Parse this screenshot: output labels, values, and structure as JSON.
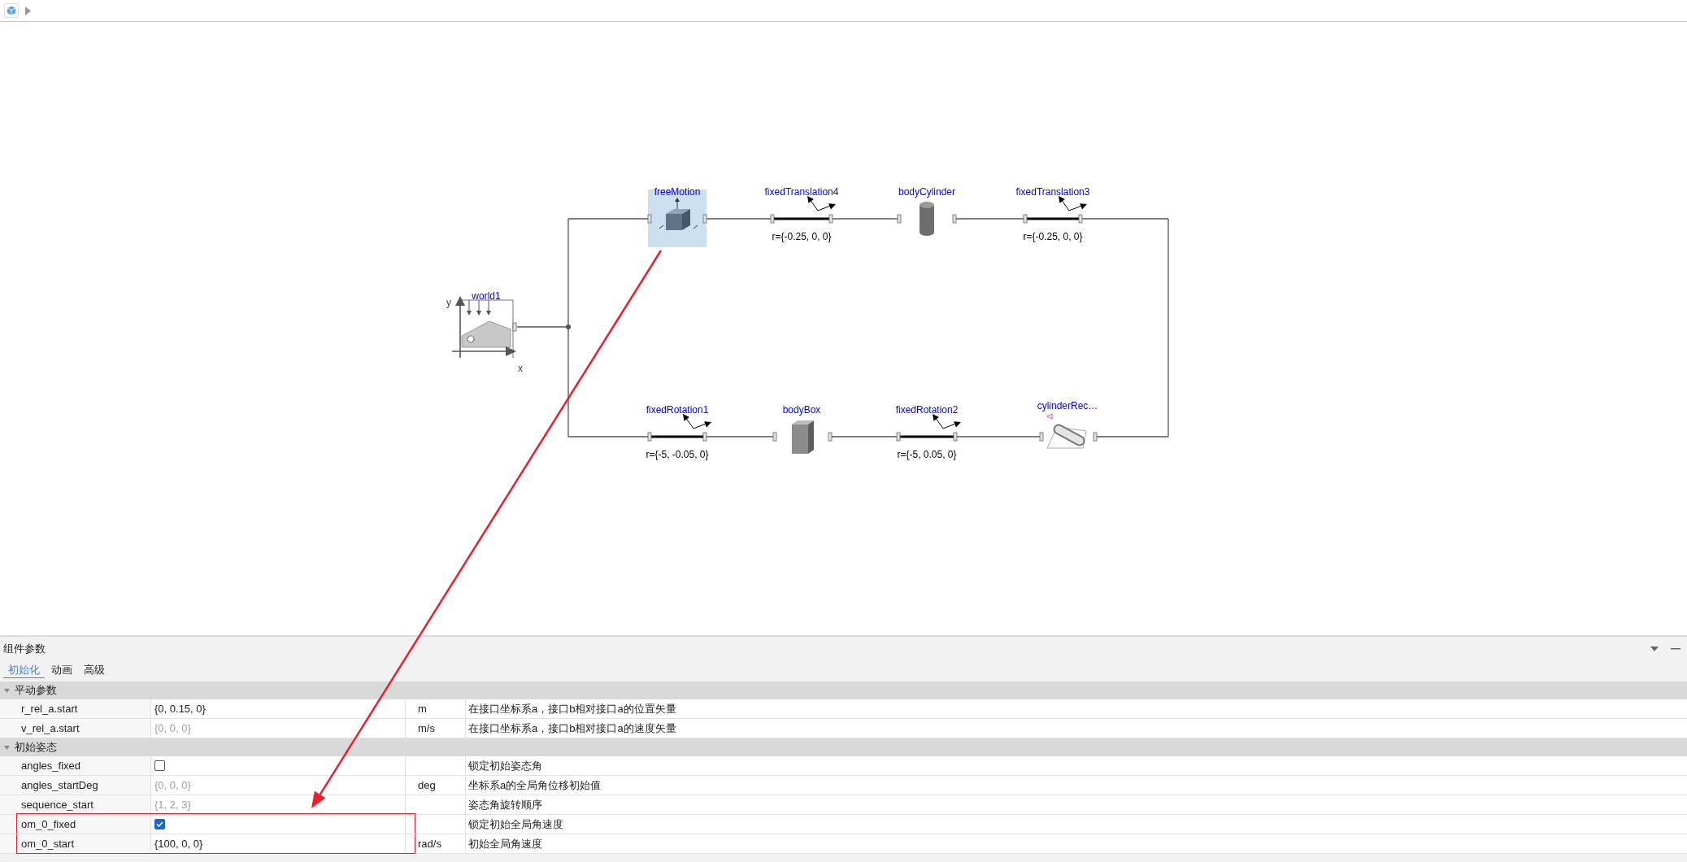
{
  "diagram": {
    "components": [
      {
        "name": "world1",
        "kind": "world",
        "selected": false,
        "axis_y": "y",
        "axis_x": "x"
      },
      {
        "name": "freeMotion",
        "kind": "free_motion",
        "selected": true
      },
      {
        "name": "fixedTranslation4",
        "kind": "fixed_translation",
        "selected": false,
        "param": "r={-0.25, 0, 0}"
      },
      {
        "name": "bodyCylinder",
        "kind": "body_cylinder",
        "selected": false
      },
      {
        "name": "fixedTranslation3",
        "kind": "fixed_translation",
        "selected": false,
        "param": "r={-0.25, 0, 0}"
      },
      {
        "name": "fixedRotation1",
        "kind": "fixed_rotation",
        "selected": false,
        "param": "r={-5, -0.05, 0}"
      },
      {
        "name": "bodyBox",
        "kind": "body_box",
        "selected": false
      },
      {
        "name": "fixedRotation2",
        "kind": "fixed_rotation",
        "selected": false,
        "param": "r={-5, 0.05, 0}"
      },
      {
        "name": "cylinderRec…",
        "kind": "cylinder_joint",
        "selected": false
      }
    ]
  },
  "panel": {
    "title": "组件参数",
    "tabs": [
      {
        "label": "初始化",
        "selected": true
      },
      {
        "label": "动画",
        "selected": false
      },
      {
        "label": "高级",
        "selected": false
      }
    ],
    "groups": [
      {
        "label": "平动参数",
        "expanded": true,
        "rows": [
          {
            "name": "r_rel_a.start",
            "kind": "text",
            "value": "{0, 0.15, 0}",
            "default": false,
            "unit": "m",
            "description": "在接口坐标系a，接口b相对接口a的位置矢量",
            "highlighted": false
          },
          {
            "name": "v_rel_a.start",
            "kind": "text",
            "value": "{0, 0, 0}",
            "default": true,
            "unit": "m/s",
            "description": "在接口坐标系a，接口b相对接口a的速度矢量",
            "highlighted": false
          }
        ]
      },
      {
        "label": "初始姿态",
        "expanded": true,
        "rows": [
          {
            "name": "angles_fixed",
            "kind": "checkbox",
            "checked": false,
            "description": "锁定初始姿态角",
            "highlighted": false
          },
          {
            "name": "angles_startDeg",
            "kind": "text",
            "value": "{0, 0, 0}",
            "default": true,
            "unit": "deg",
            "description": "坐标系a的全局角位移初始值",
            "highlighted": false
          },
          {
            "name": "sequence_start",
            "kind": "text",
            "value": "{1, 2, 3}",
            "default": true,
            "description": "姿态角旋转顺序",
            "highlighted": false
          },
          {
            "name": "om_0_fixed",
            "kind": "checkbox",
            "checked": true,
            "description": "锁定初始全局角速度",
            "highlighted": true
          },
          {
            "name": "om_0_start",
            "kind": "text",
            "value": "{100, 0, 0}",
            "default": false,
            "unit": "rad/s",
            "description": "初始全局角速度",
            "highlighted": true
          }
        ]
      }
    ]
  }
}
